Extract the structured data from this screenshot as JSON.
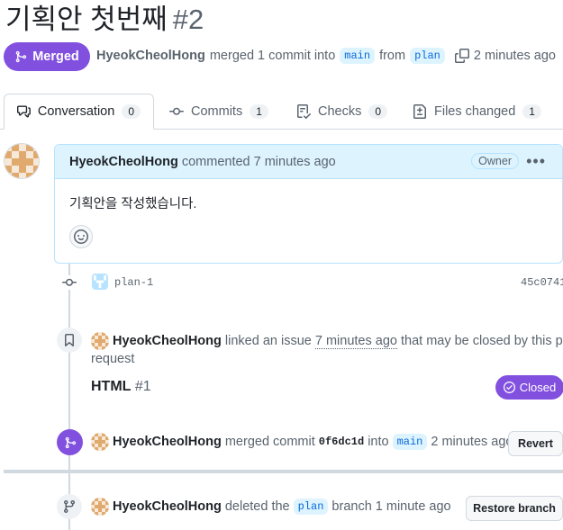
{
  "pr": {
    "title": "기획안 첫번째",
    "number": "#2",
    "status": "Merged",
    "author": "HyeokCheolHong",
    "merge_text": "merged 1 commit into",
    "base_branch": "main",
    "from_text": "from",
    "head_branch": "plan",
    "time": "2 minutes ago"
  },
  "tabs": [
    {
      "label": "Conversation",
      "count": "0"
    },
    {
      "label": "Commits",
      "count": "1"
    },
    {
      "label": "Checks",
      "count": "0"
    },
    {
      "label": "Files changed",
      "count": "1"
    }
  ],
  "comment": {
    "author": "HyeokCheolHong",
    "action": "commented 7 minutes ago",
    "badge": "Owner",
    "body": "기획안을 작성했습니다."
  },
  "commit": {
    "message": "plan-1",
    "sha": "45c0741"
  },
  "linked_issue": {
    "author": "HyeokCheolHong",
    "text_before": "linked an issue",
    "time": "7 minutes ago",
    "text_mid": "that may be",
    "closed_word": "closed",
    "text_after": "by this pull",
    "text_wrap": "request",
    "issue_title": "HTML",
    "issue_number": "#1",
    "state": "Closed"
  },
  "merge_event": {
    "author": "HyeokCheolHong",
    "text": "merged commit",
    "sha": "0f6dc1d",
    "into": "into",
    "branch": "main",
    "time": "2 minutes ago",
    "button": "Revert"
  },
  "delete_event": {
    "author": "HyeokCheolHong",
    "text": "deleted the",
    "branch": "plan",
    "text_after": "branch 1 minute ago",
    "button": "Restore branch"
  },
  "colors": {
    "merged": "#8250df",
    "accent_blue": "#0969da",
    "border": "#d1d9e0"
  }
}
